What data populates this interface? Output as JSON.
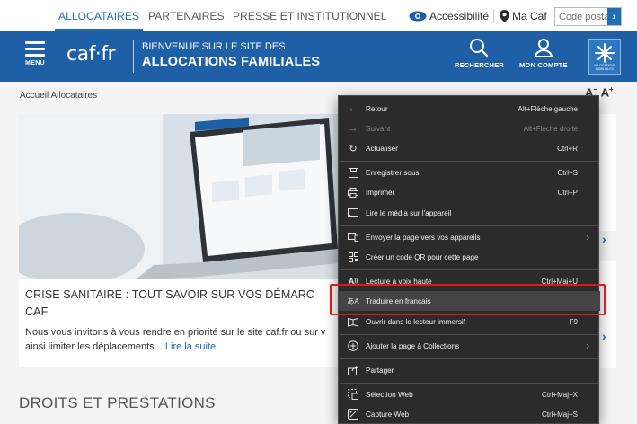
{
  "topbar": {
    "tabs": [
      "ALLOCATAIRES",
      "PARTENAIRES",
      "PRESSE ET INSTITUTIONNEL"
    ],
    "accessibility": "Accessibilité",
    "ma_caf": "Ma Caf",
    "postal_placeholder": "Code postal",
    "postal_go": "›"
  },
  "header": {
    "menu_label": "MENU",
    "logo": "caf·fr",
    "welcome_line1": "BIENVENUE SUR LE SITE DES",
    "welcome_line2": "ALLOCATIONS FAMILIALES",
    "search_label": "RECHERCHER",
    "account_label": "MON COMPTE",
    "badge_text": "ALLOCATIONS FAMILIALES"
  },
  "breadcrumb": "Accueil Allocataires",
  "font_size_controls": {
    "decrease": "A",
    "increase": "A"
  },
  "card": {
    "title": "CRISE SANITAIRE : TOUT SAVOIR SUR VOS DÉMARC",
    "title_line2": "CAF",
    "description": "Nous vous invitons à vous rendre en priorité sur le site caf.fr ou sur v ainsi limiter les déplacements...",
    "read_more": "Lire la suite"
  },
  "section_title": "DROITS ET PRESTATIONS",
  "context_menu": {
    "items": [
      {
        "label": "Retour",
        "shortcut": "Alt+Flèche gauche",
        "icon": "arrow-left-icon",
        "disabled": false
      },
      {
        "label": "Suivant",
        "shortcut": "Alt+Flèche droite",
        "icon": "arrow-right-icon",
        "disabled": true
      },
      {
        "label": "Actualiser",
        "shortcut": "Ctrl+R",
        "icon": "refresh-icon",
        "disabled": false
      },
      {
        "label": "Enregistrer sous",
        "shortcut": "Ctrl+S",
        "icon": "save-icon",
        "disabled": false
      },
      {
        "label": "Imprimer",
        "shortcut": "Ctrl+P",
        "icon": "print-icon",
        "disabled": false
      },
      {
        "label": "Lire le média sur l'appareil",
        "shortcut": "",
        "icon": "cast-icon",
        "disabled": false
      },
      {
        "label": "Envoyer la page vers vos appareils",
        "shortcut": "",
        "icon": "devices-icon",
        "disabled": false,
        "submenu": true
      },
      {
        "label": "Créer un code QR pour cette page",
        "shortcut": "",
        "icon": "qr-code-icon",
        "disabled": false
      },
      {
        "label": "Lecture à voix haute",
        "shortcut": "Ctrl+Maj+U",
        "icon": "read-aloud-icon",
        "disabled": false
      },
      {
        "label": "Traduire en français",
        "shortcut": "",
        "icon": "translate-icon",
        "disabled": false
      },
      {
        "label": "Ouvrir dans le lecteur immersif",
        "shortcut": "F9",
        "icon": "immersive-reader-icon",
        "disabled": false
      },
      {
        "label": "Ajouter la page à Collections",
        "shortcut": "",
        "icon": "collections-icon",
        "disabled": false,
        "submenu": true
      },
      {
        "label": "Partager",
        "shortcut": "",
        "icon": "share-icon",
        "disabled": false
      },
      {
        "label": "Sélection Web",
        "shortcut": "Ctrl+Maj+X",
        "icon": "web-select-icon",
        "disabled": false
      },
      {
        "label": "Capture Web",
        "shortcut": "Ctrl+Maj+S",
        "icon": "web-capture-icon",
        "disabled": false
      }
    ]
  },
  "colors": {
    "brand_blue": "#1f5fa5",
    "link_blue": "#1f6db5",
    "menu_bg": "#2b2b2b",
    "highlight_box": "#e01a1a"
  }
}
